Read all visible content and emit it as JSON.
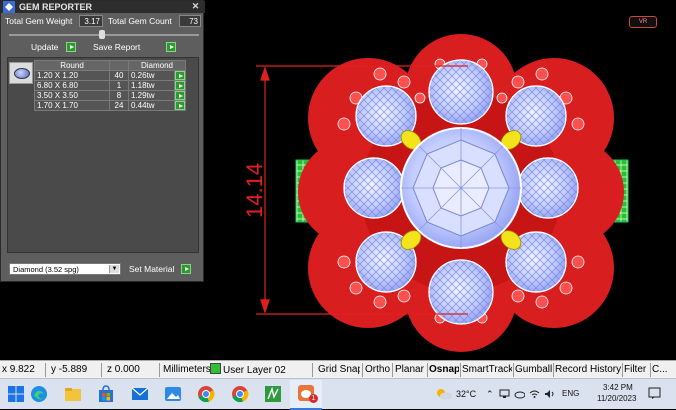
{
  "gem_reporter": {
    "title": "GEM REPORTER",
    "close_label": "✕",
    "total_gem_weight_label": "Total Gem Weight",
    "total_gem_weight_value": "3.17",
    "total_gem_count_label": "Total Gem Count",
    "total_gem_count_value": "73",
    "update_label": "Update",
    "save_report_label": "Save Report",
    "table": {
      "headers": [
        "Round",
        "",
        "Diamond"
      ],
      "rows": [
        {
          "size": "1.20 X 1.20",
          "count": "40",
          "weight": "0.26tw"
        },
        {
          "size": "6.80 X 6.80",
          "count": "1",
          "weight": "1.18tw"
        },
        {
          "size": "3.50 X 3.50",
          "count": "8",
          "weight": "1.29tw"
        },
        {
          "size": "1.70 X 1.70",
          "count": "24",
          "weight": "0.44tw"
        }
      ]
    },
    "material_value": "Diamond    (3.52 spg)",
    "set_material_label": "Set Material"
  },
  "viewport": {
    "dimension_label": "14.14",
    "badge_text": "VR"
  },
  "statusbar": {
    "x": "x 9.822",
    "y": "y -5.889",
    "z": "z 0.000",
    "units": "Millimeters",
    "layer": "User Layer 02",
    "toggles": [
      "Grid Snap",
      "Ortho",
      "Planar",
      "Osnap",
      "SmartTrack",
      "Gumball",
      "Record History",
      "Filter",
      "C..."
    ]
  },
  "taskbar": {
    "temperature": "32°C",
    "language": "ENG",
    "time": "3:42 PM",
    "date": "11/20/2023",
    "notification_badge": "1"
  },
  "colors": {
    "ring_red": "#d81e1e",
    "gem_blue": "#bcc8ff",
    "accent_gem_yellow": "#f2e31a",
    "green_gems": "#22b822",
    "dimension_line": "#e02020"
  }
}
